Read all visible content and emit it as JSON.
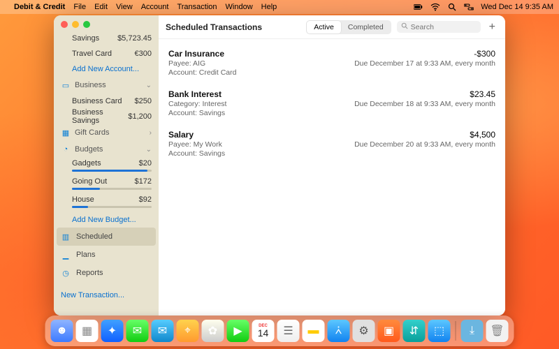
{
  "menubar": {
    "app": "Debit & Credit",
    "items": [
      "File",
      "Edit",
      "View",
      "Account",
      "Transaction",
      "Window",
      "Help"
    ],
    "clock": "Wed Dec 14  9:35 AM"
  },
  "sidebar": {
    "accounts": [
      {
        "label": "Savings",
        "amount": "$5,723.45"
      },
      {
        "label": "Travel Card",
        "amount": "€300"
      }
    ],
    "add_account": "Add New Account...",
    "business": {
      "label": "Business",
      "items": [
        {
          "label": "Business Card",
          "amount": "$250"
        },
        {
          "label": "Business Savings",
          "amount": "$1,200"
        }
      ]
    },
    "giftcards": {
      "label": "Gift Cards"
    },
    "budgets": {
      "label": "Budgets",
      "items": [
        {
          "label": "Gadgets",
          "amount": "$20",
          "pct": 95
        },
        {
          "label": "Going Out",
          "amount": "$172",
          "pct": 35
        },
        {
          "label": "House",
          "amount": "$92",
          "pct": 20
        }
      ],
      "add": "Add New Budget..."
    },
    "nav": {
      "scheduled": "Scheduled",
      "plans": "Plans",
      "reports": "Reports"
    },
    "new_tx": "New Transaction..."
  },
  "main": {
    "title": "Scheduled Transactions",
    "tabs": {
      "active": "Active",
      "completed": "Completed"
    },
    "search_ph": "Search",
    "transactions": [
      {
        "name": "Car Insurance",
        "amount": "-$300",
        "neg": true,
        "meta_l": "Payee: AIG",
        "meta_r": "Due December 17 at 9:33 AM, every month",
        "meta2": "Account: Credit Card"
      },
      {
        "name": "Bank Interest",
        "amount": "$23.45",
        "neg": false,
        "meta_l": "Category: Interest",
        "meta_r": "Due December 18 at 9:33 AM, every month",
        "meta2": "Account: Savings"
      },
      {
        "name": "Salary",
        "amount": "$4,500",
        "neg": false,
        "meta_l": "Payee: My Work",
        "meta_r": "Due December 20 at 9:33 AM, every month",
        "meta2": "Account: Savings"
      }
    ]
  },
  "dock": {
    "date_month": "DEC",
    "date_day": "14"
  }
}
